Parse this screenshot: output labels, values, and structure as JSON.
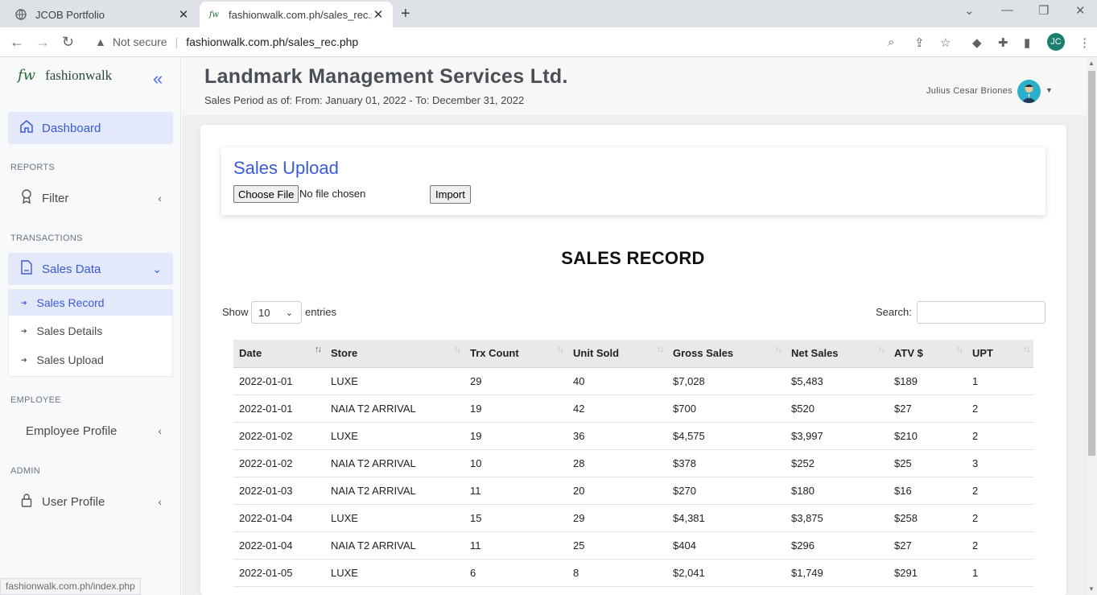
{
  "browser": {
    "tabs": [
      {
        "title": "JCOB Portfolio",
        "active": false
      },
      {
        "title": "fashionwalk.com.ph/sales_rec.php",
        "active": true
      }
    ],
    "not_secure": "Not secure",
    "url": "fashionwalk.com.ph/sales_rec.php",
    "profile_initials": "JC",
    "status_url": "fashionwalk.com.ph/index.php"
  },
  "sidebar": {
    "brand_logo": "fw",
    "brand_name": "fashionwalk",
    "dashboard": "Dashboard",
    "sections": {
      "reports": "REPORTS",
      "transactions": "TRANSACTIONS",
      "employee": "EMPLOYEE",
      "admin": "ADMIN"
    },
    "filter": "Filter",
    "sales_data": "Sales Data",
    "sub_items": [
      "Sales Record",
      "Sales Details",
      "Sales Upload"
    ],
    "employee_profile": "Employee Profile",
    "user_profile": "User Profile"
  },
  "header": {
    "title": "Landmark Management Services Ltd.",
    "period": "Sales Period as of: From: January 01, 2022 - To: December 31, 2022",
    "user_name": "Julius Cesar Briones"
  },
  "upload": {
    "title": "Sales Upload",
    "choose_label": "Choose File",
    "no_file": "No file chosen",
    "import_label": "Import"
  },
  "records": {
    "title": "SALES RECORD",
    "show_label": "Show",
    "page_length": "10",
    "entries_label": "entries",
    "search_label": "Search:",
    "columns": [
      "Date",
      "Store",
      "Trx Count",
      "Unit Sold",
      "Gross Sales",
      "Net Sales",
      "ATV $",
      "UPT"
    ],
    "rows": [
      [
        "2022-01-01",
        "LUXE",
        "29",
        "40",
        "$7,028",
        "$5,483",
        "$189",
        "1"
      ],
      [
        "2022-01-01",
        "NAIA T2 ARRIVAL",
        "19",
        "42",
        "$700",
        "$520",
        "$27",
        "2"
      ],
      [
        "2022-01-02",
        "LUXE",
        "19",
        "36",
        "$4,575",
        "$3,997",
        "$210",
        "2"
      ],
      [
        "2022-01-02",
        "NAIA T2 ARRIVAL",
        "10",
        "28",
        "$378",
        "$252",
        "$25",
        "3"
      ],
      [
        "2022-01-03",
        "NAIA T2 ARRIVAL",
        "11",
        "20",
        "$270",
        "$180",
        "$16",
        "2"
      ],
      [
        "2022-01-04",
        "LUXE",
        "15",
        "29",
        "$4,381",
        "$3,875",
        "$258",
        "2"
      ],
      [
        "2022-01-04",
        "NAIA T2 ARRIVAL",
        "11",
        "25",
        "$404",
        "$296",
        "$27",
        "2"
      ],
      [
        "2022-01-05",
        "LUXE",
        "6",
        "8",
        "$2,041",
        "$1,749",
        "$291",
        "1"
      ]
    ]
  },
  "colors": {
    "accent": "#3a5bd9",
    "active_bg": "#e3e8fb"
  }
}
